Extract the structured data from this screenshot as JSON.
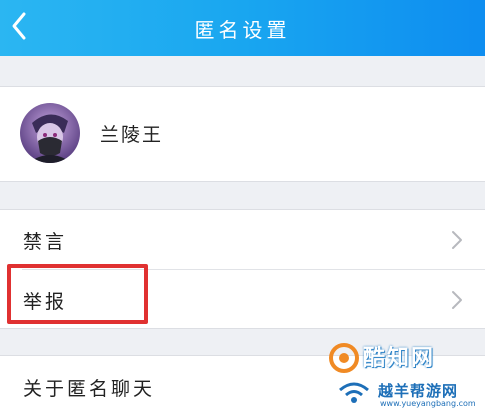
{
  "header": {
    "title": "匿名设置",
    "back_icon": "chevron-left-icon"
  },
  "profile": {
    "name": "兰陵王",
    "avatar": "character-avatar"
  },
  "menu": {
    "items": [
      {
        "label": "禁言",
        "icon": "chevron-right-icon"
      },
      {
        "label": "举报",
        "icon": "chevron-right-icon"
      }
    ]
  },
  "about": {
    "label": "关于匿名聊天"
  },
  "watermark": {
    "brand": "酷知网",
    "brand2": "越羊帮游网",
    "url": "www.yueyangbang.com"
  },
  "colors": {
    "header_start": "#2bb6f2",
    "header_end": "#0e8df0",
    "highlight": "#e03131"
  }
}
